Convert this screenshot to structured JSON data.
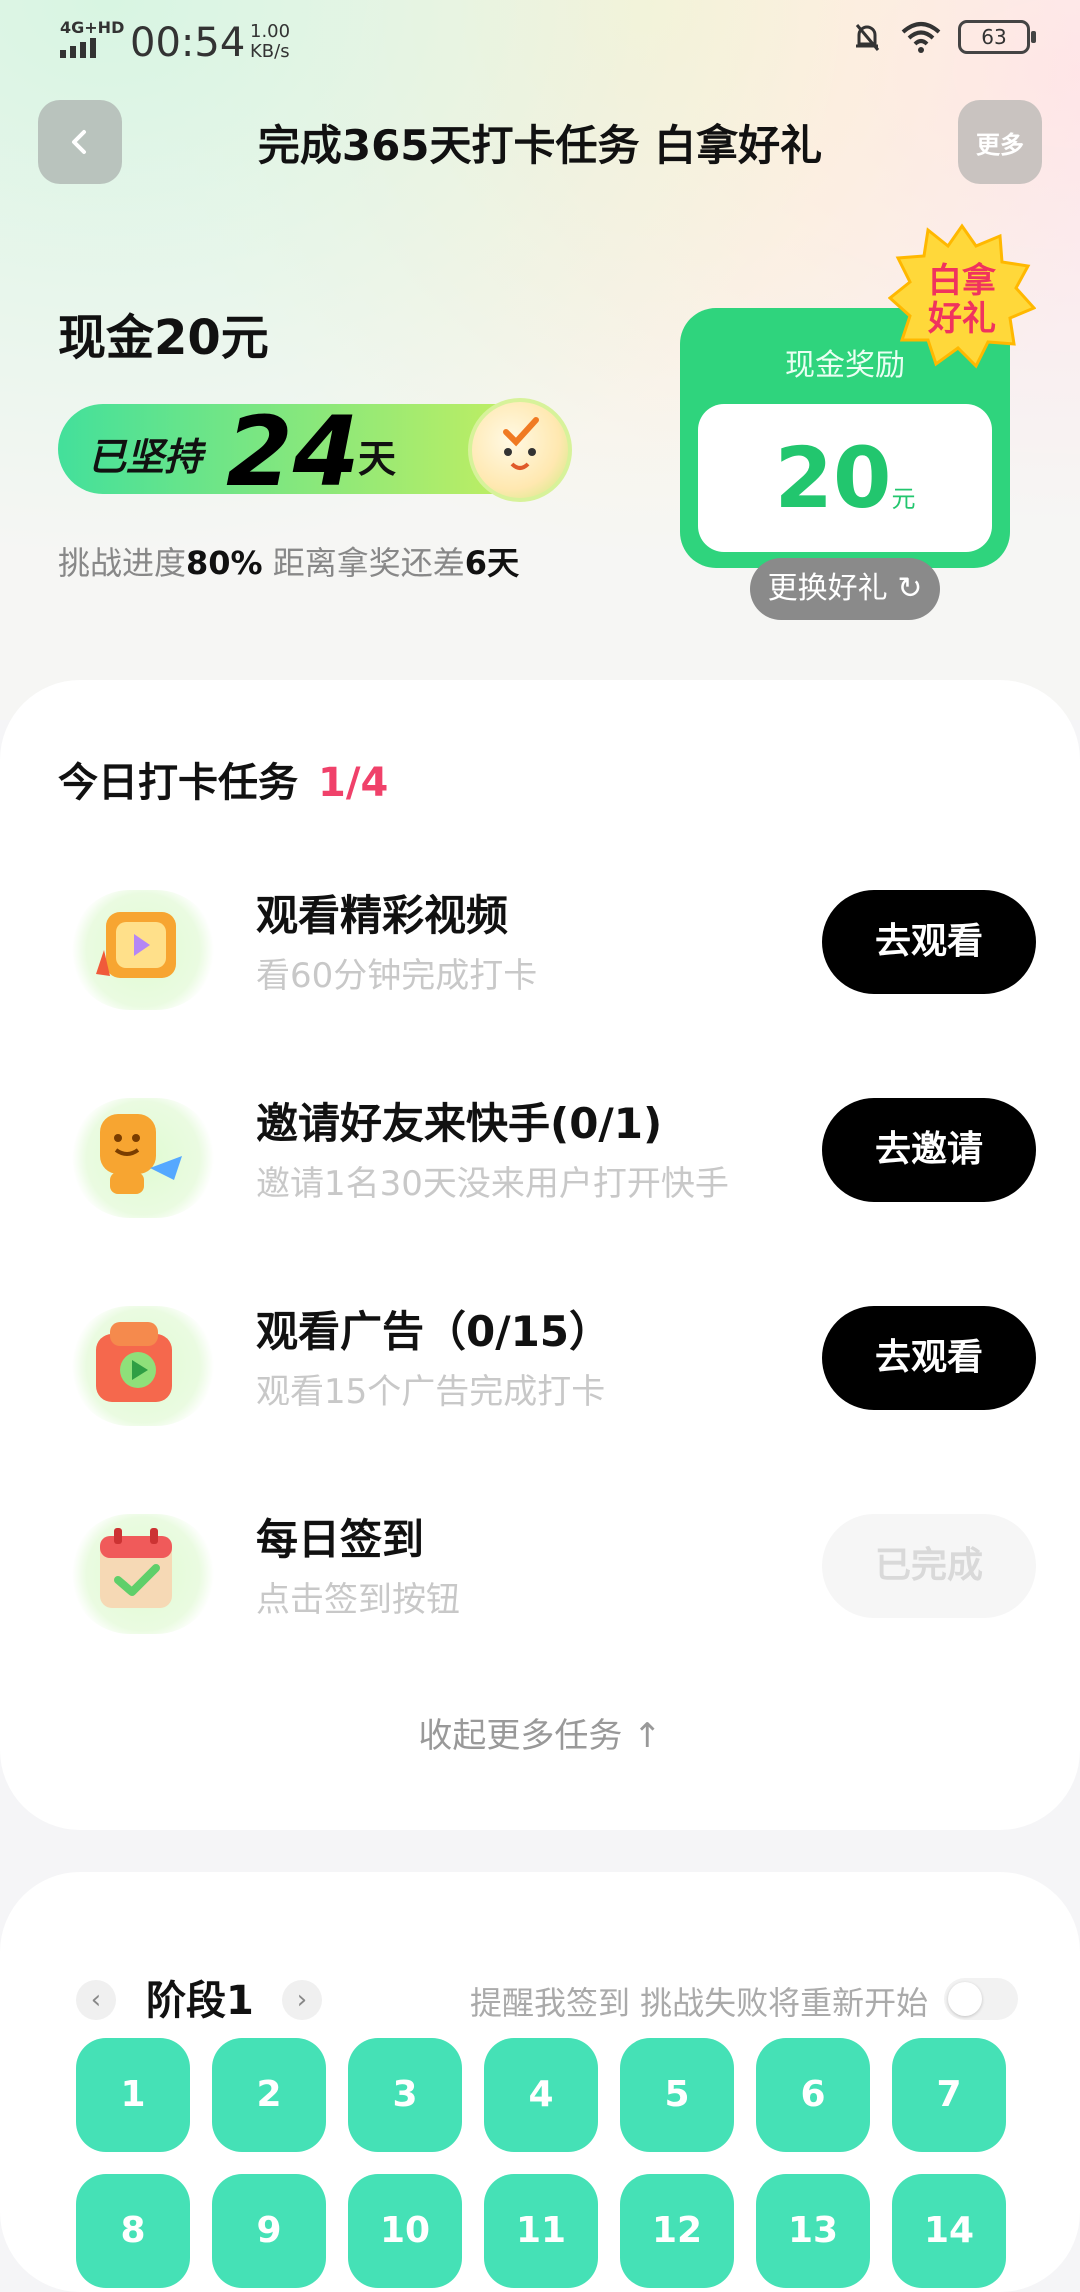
{
  "status_bar": {
    "network": "4G+HD",
    "time": "00:54",
    "speed_value": "1.00",
    "speed_unit": "KB/s",
    "battery": "63"
  },
  "nav": {
    "title": "完成365天打卡任务 白拿好礼",
    "more_label": "更多"
  },
  "hero": {
    "reward_title": "现金20元",
    "streak_prefix": "已坚持",
    "streak_days": "24",
    "streak_unit": "天",
    "progress_prefix": "挑战进度",
    "progress_value": "80%",
    "remain_prefix": " 距离拿奖还差",
    "remain_value": "6天",
    "cash_label": "现金奖励",
    "cash_value": "20",
    "cash_unit": "元",
    "badge_line1": "白拿",
    "badge_line2": "好礼",
    "swap_label": "更换好礼 ↻"
  },
  "tasks": {
    "title": "今日打卡任务",
    "count": "1/4",
    "items": [
      {
        "name": "观看精彩视频",
        "desc": "看60分钟完成打卡",
        "button": "去观看",
        "done": false
      },
      {
        "name": "邀请好友来快手(0/1)",
        "desc": "邀请1名30天没来用户打开快手",
        "button": "去邀请",
        "done": false
      },
      {
        "name": "观看广告（0/15）",
        "desc": "观看15个广告完成打卡",
        "button": "去观看",
        "done": false
      },
      {
        "name": "每日签到",
        "desc": "点击签到按钮",
        "button": "已完成",
        "done": true
      }
    ],
    "collapse_label": "收起更多任务 ↑"
  },
  "stage": {
    "prev": "‹",
    "next": "›",
    "name": "阶段1",
    "remind_text": "提醒我签到 挑战失败将重新开始",
    "days": [
      "1",
      "2",
      "3",
      "4",
      "5",
      "6",
      "7",
      "8",
      "9",
      "10",
      "11",
      "12",
      "13",
      "14"
    ]
  },
  "colors": {
    "accent_green": "#2fd47d",
    "day_green": "#45e1b6",
    "count_red": "#f0416a"
  }
}
